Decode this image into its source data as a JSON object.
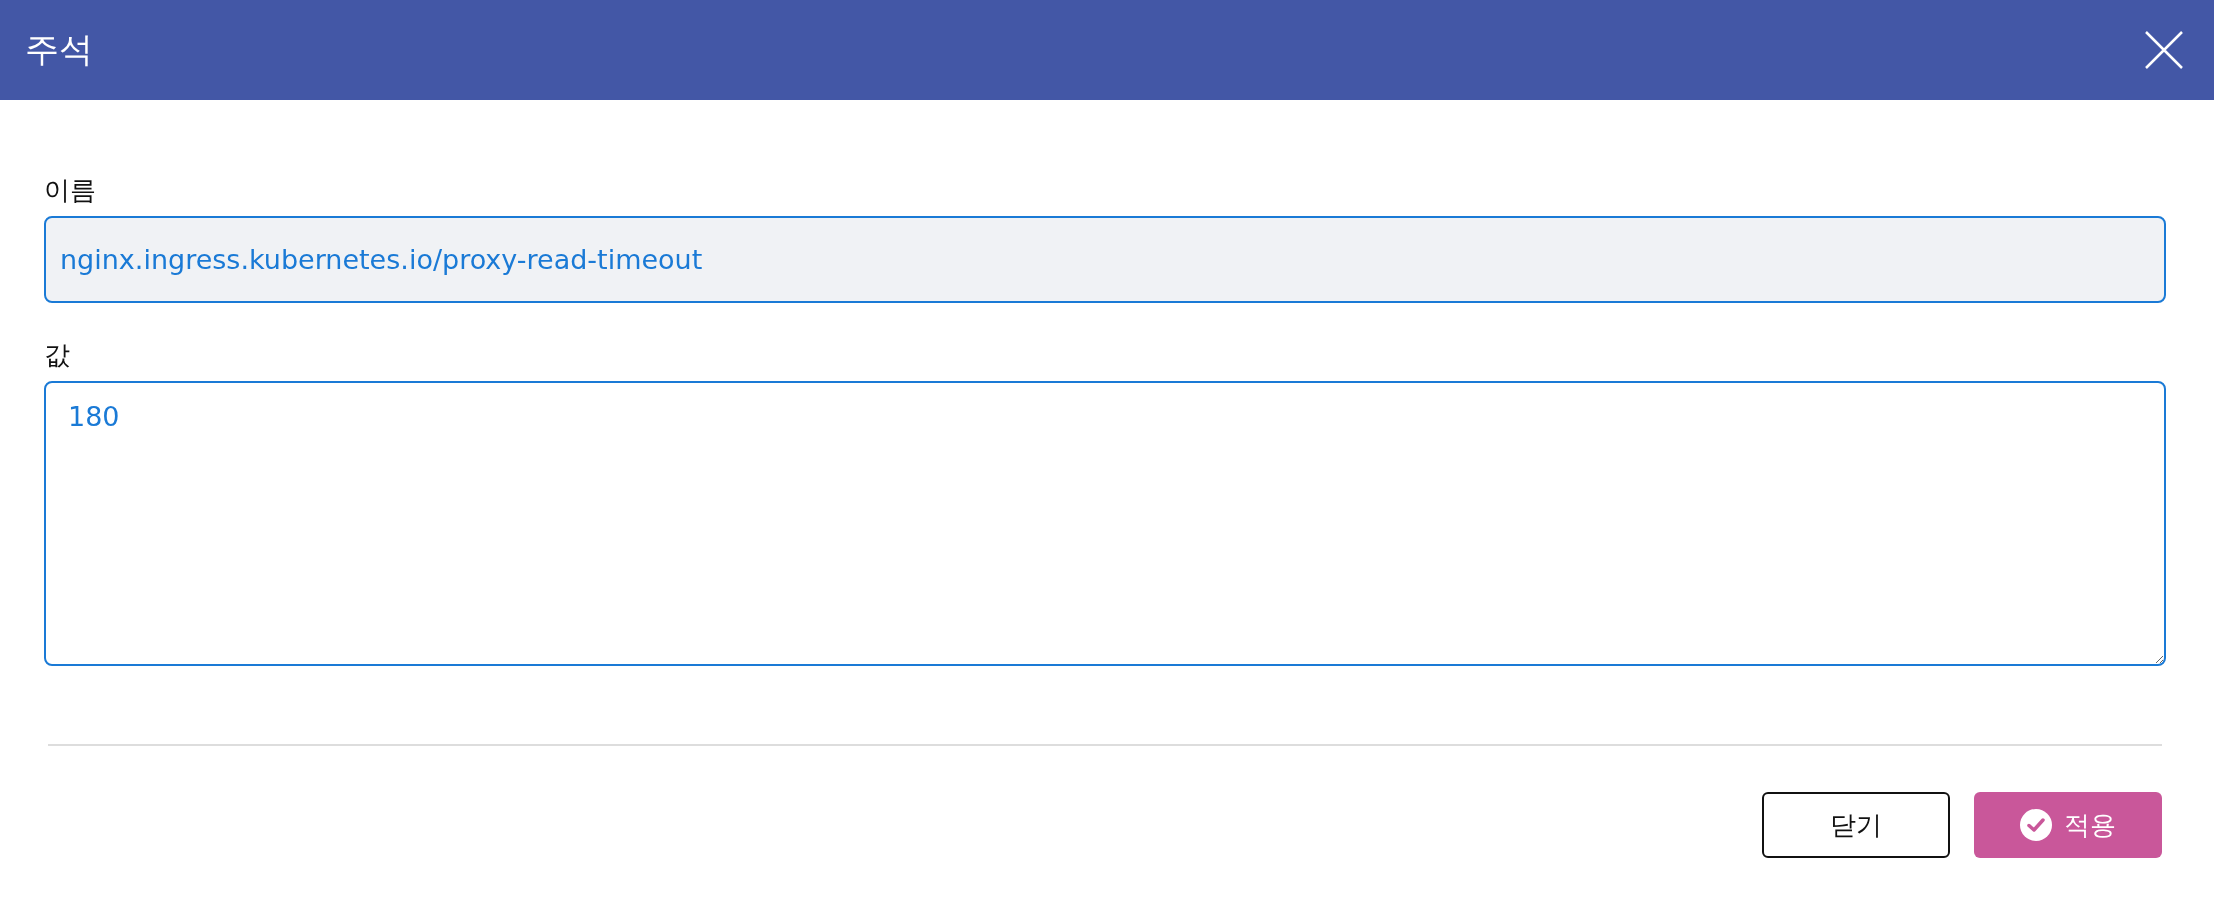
{
  "dialog": {
    "title": "주석"
  },
  "fields": [
    {
      "kind": "input",
      "label": "이름",
      "value": "nginx.ingress.kubernetes.io/proxy-read-timeout"
    },
    {
      "kind": "textarea",
      "label": "값",
      "value": "180"
    }
  ],
  "buttons": [
    {
      "kind": "secondary",
      "label": "닫기"
    },
    {
      "kind": "primary",
      "label": "적용"
    }
  ]
}
